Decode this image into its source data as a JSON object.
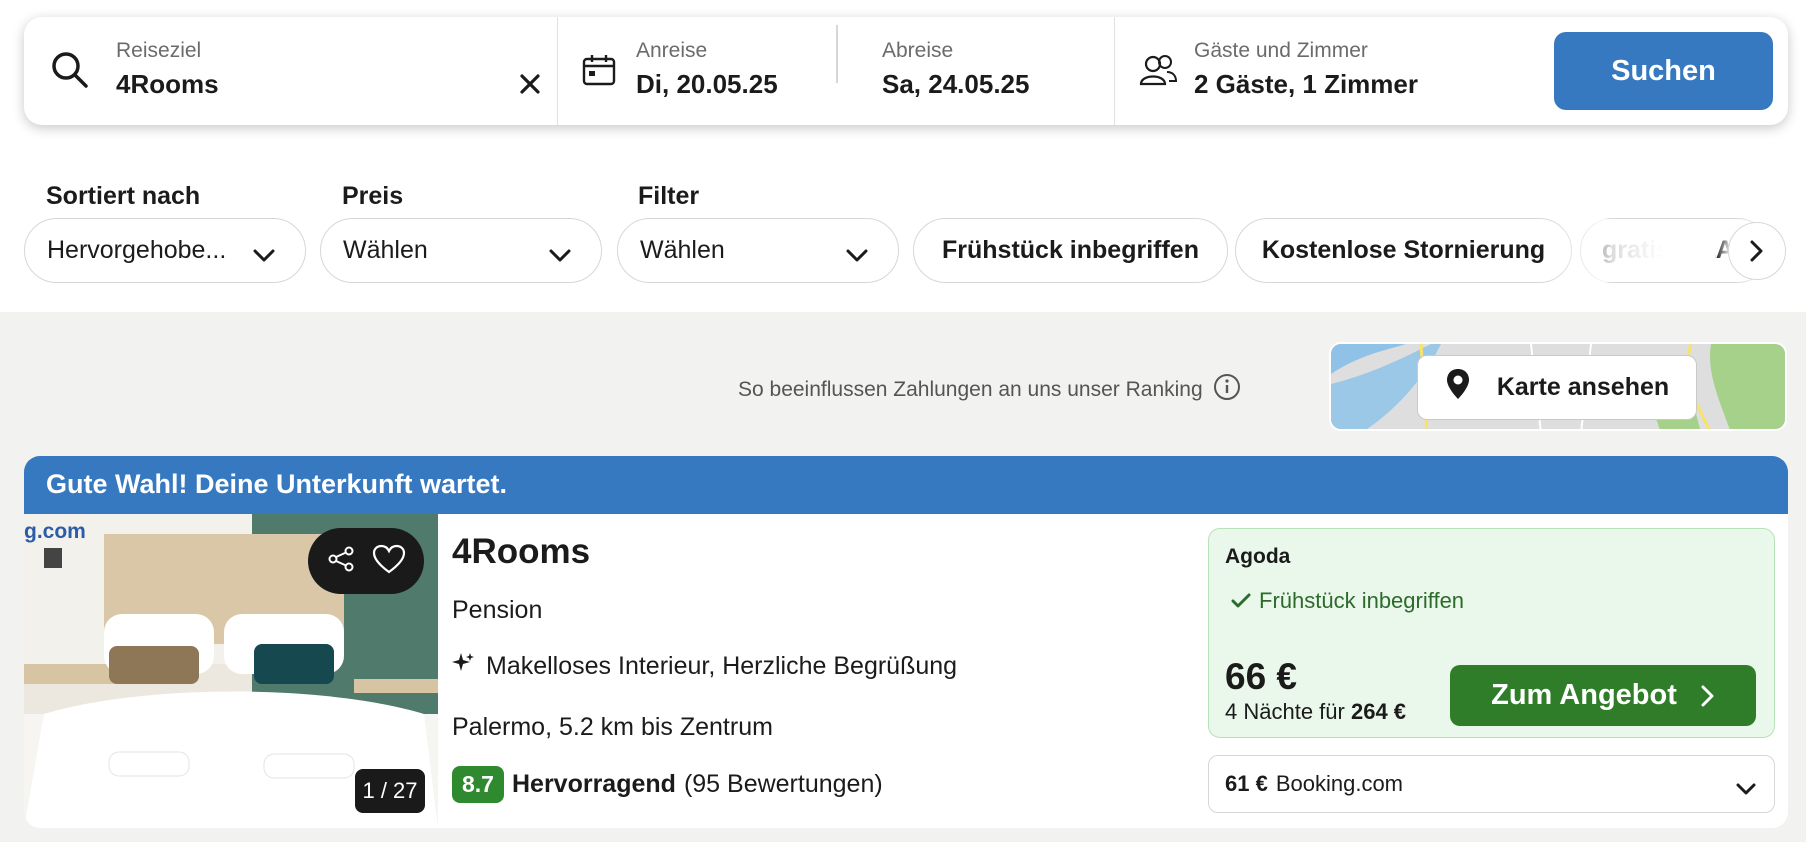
{
  "search": {
    "destination_label": "Reiseziel",
    "destination_value": "4Rooms",
    "checkin_label": "Anreise",
    "checkin_value": "Di, 20.05.25",
    "checkout_label": "Abreise",
    "checkout_value": "Sa, 24.05.25",
    "guests_label": "Gäste und Zimmer",
    "guests_value": "2 Gäste, 1 Zimmer",
    "search_button": "Suchen"
  },
  "filters": {
    "sort_label": "Sortiert nach",
    "sort_value": "Hervorgehobe...",
    "price_label": "Preis",
    "price_value": "Wählen",
    "filter_label": "Filter",
    "filter_value": "Wählen",
    "chips": [
      "Frühstück inbegriffen",
      "Kostenlose Stornierung",
      "gratis WLAN"
    ]
  },
  "ranking_text": "So beeinflussen Zahlungen an uns unser Ranking",
  "map_button": "Karte ansehen",
  "card": {
    "banner": "Gute Wahl! Deine Unterkunft wartet.",
    "photo_counter": "1 / 27",
    "photo_watermark": "g.com",
    "name": "4Rooms",
    "type": "Pension",
    "highlights": "Makelloses Interieur, Herzliche Begrüßung",
    "location": "Palermo, 5.2 km bis Zentrum",
    "rating_score": "8.7",
    "rating_word": "Hervorragend",
    "rating_count": "(95 Bewertungen)",
    "offer": {
      "provider": "Agoda",
      "feature": "Frühstück inbegriffen",
      "price": "66 €",
      "total_prefix": "4 Nächte für",
      "total_value": "264 €",
      "button": "Zum Angebot"
    },
    "alt_offer": {
      "price": "61 €",
      "provider": "Booking.com"
    }
  },
  "colors": {
    "primary_blue": "#3679c1",
    "offer_green": "#2f7d28",
    "rating_green": "#2f8a2f",
    "offer_bg": "#e9f8ea"
  }
}
